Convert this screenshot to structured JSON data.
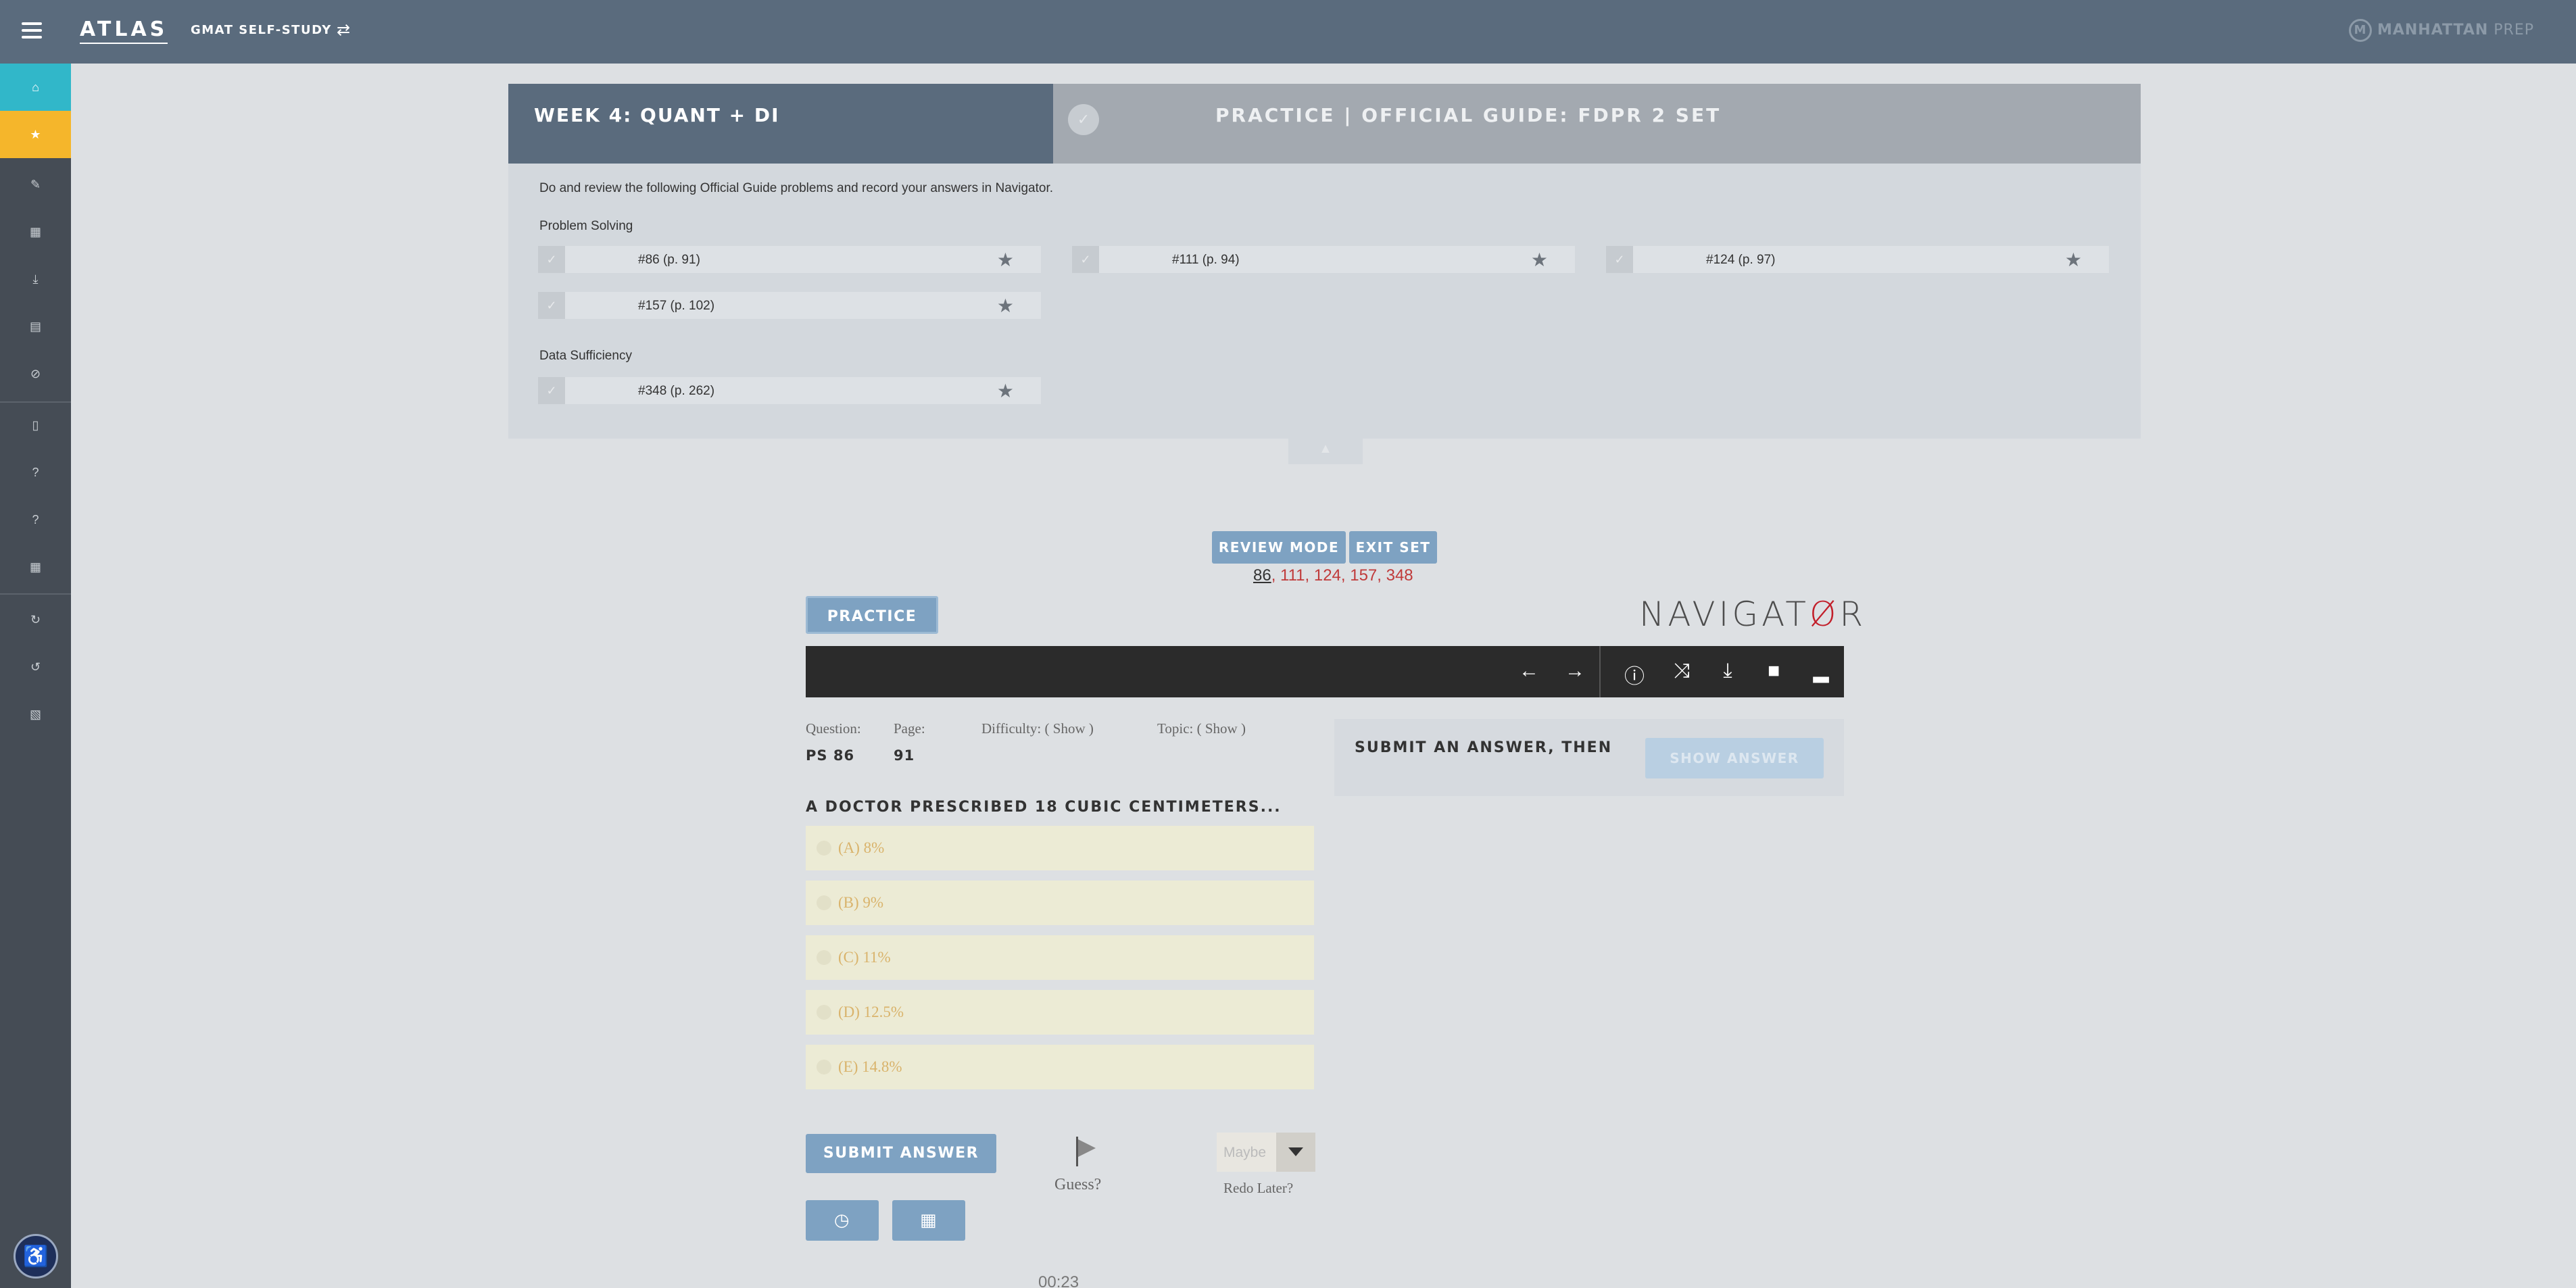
{
  "header": {
    "logo": "ATLAS",
    "course": "GMAT SELF-STUDY",
    "brand_bold": "MANHATTAN",
    "brand_light": " PREP"
  },
  "week": {
    "title": "WEEK 4: QUANT + DI",
    "practice_title": "PRACTICE | OFFICIAL GUIDE: FDPR 2 SET",
    "instructions": "Do and review the following Official Guide problems and record your answers in Navigator.",
    "sections": [
      {
        "label": "Problem Solving",
        "problems": [
          "#86 (p. 91)",
          "#111 (p. 94)",
          "#124 (p. 97)",
          "#157 (p. 102)"
        ]
      },
      {
        "label": "Data Sufficiency",
        "problems": [
          "#348 (p. 262)"
        ]
      }
    ]
  },
  "controls": {
    "review_mode": "REVIEW MODE",
    "exit_set": "EXIT SET",
    "current_q": "86",
    "other_qs": ", 111, 124, 157, 348"
  },
  "navigator": {
    "mode_tab": "PRACTICE",
    "logo_a": "NAVIGAT",
    "logo_o": "Ø",
    "logo_b": "R"
  },
  "question": {
    "question_label": "Question:",
    "question_value": "PS 86",
    "page_label": "Page:",
    "page_value": "91",
    "difficulty": "Difficulty: ( Show )",
    "topic": "Topic: ( Show )",
    "title": "A DOCTOR PRESCRIBED 18 CUBIC CENTIMETERS...",
    "choices": [
      "(A) 8%",
      "(B) 9%",
      "(C) 11%",
      "(D) 12.5%",
      "(E) 14.8%"
    ]
  },
  "actions": {
    "submit": "SUBMIT ANSWER",
    "guess": "Guess?",
    "redo_value": "Maybe",
    "redo_label": "Redo Later?",
    "timer": "00:23"
  },
  "answer_panel": {
    "hint": "SUBMIT AN ANSWER, THEN",
    "show_answer": "SHOW ANSWER"
  },
  "colors": {
    "topbar": "#5a6b7d",
    "sidebar": "#454c55",
    "home_active": "#31b7c9",
    "star_active": "#f5b62b",
    "button_blue": "#7ea2c2",
    "toolbar": "#2b2b2b",
    "accent_red": "#c21f2a"
  }
}
